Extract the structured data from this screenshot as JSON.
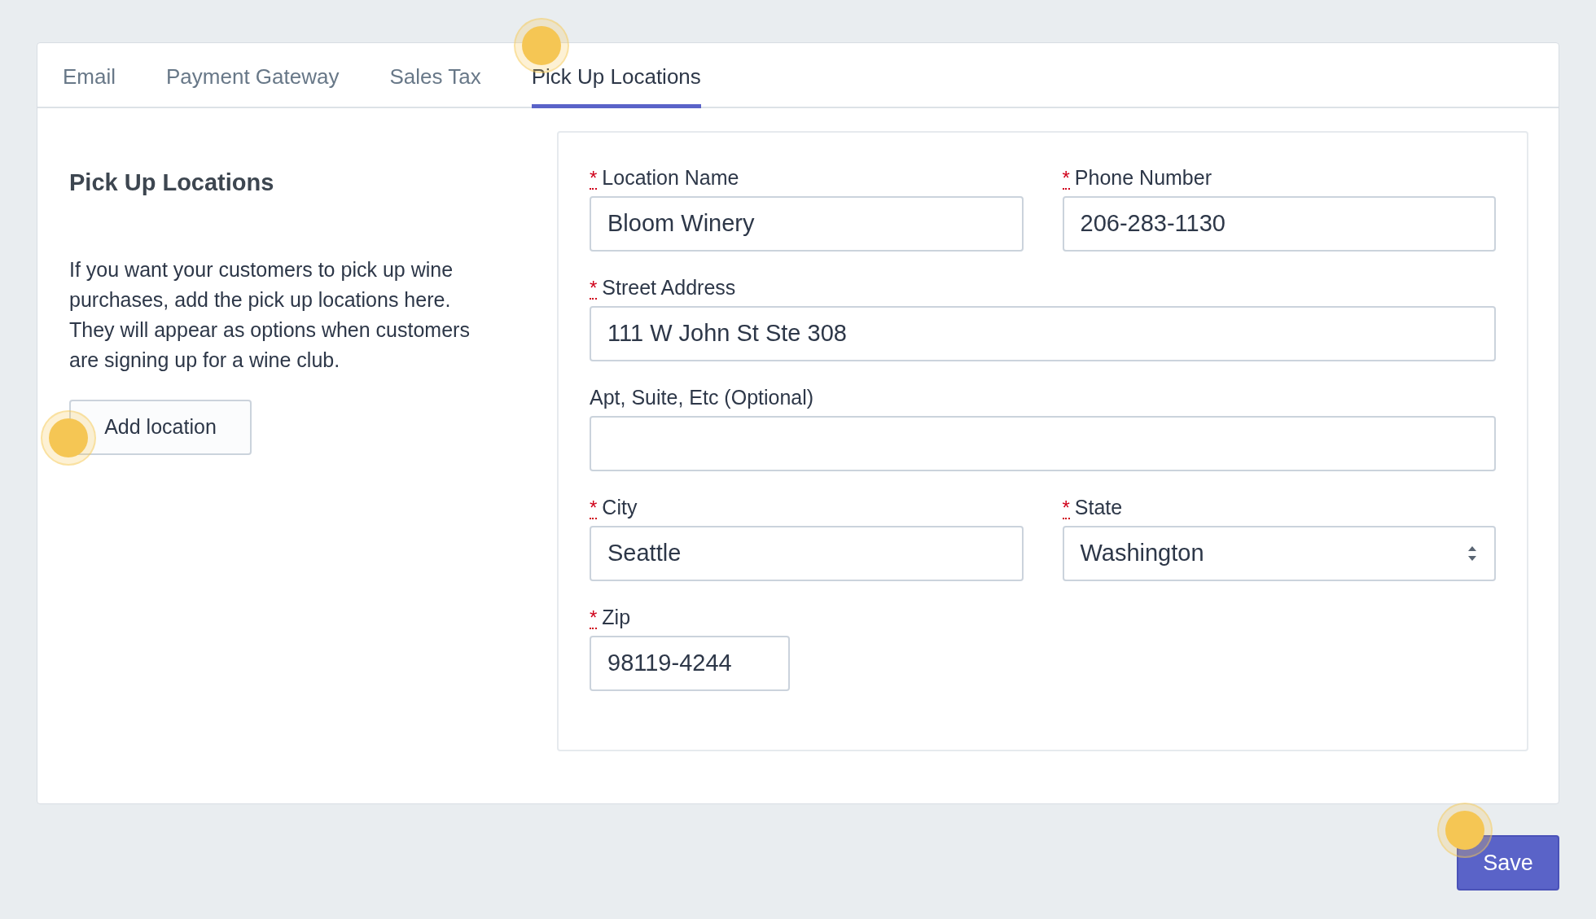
{
  "tabs": [
    {
      "label": "Email",
      "selected": false
    },
    {
      "label": "Payment Gateway",
      "selected": false
    },
    {
      "label": "Sales Tax",
      "selected": false
    },
    {
      "label": "Pick Up Locations",
      "selected": true
    }
  ],
  "section": {
    "title": "Pick Up Locations",
    "description": "If you want your customers to pick up wine purchases, add the pick up locations here. They will appear as options when customers are signing up for a wine club.",
    "add_button": "Add location"
  },
  "form_rows": [
    [
      {
        "label": "Location Name",
        "required_mark": "*",
        "kind": "text",
        "value": "Bloom Winery"
      },
      {
        "label": "Phone Number",
        "required_mark": "*",
        "kind": "text",
        "value": "206-283-1130"
      }
    ],
    [
      {
        "label": "Street Address",
        "required_mark": "*",
        "kind": "text",
        "value": "111 W John St Ste 308"
      }
    ],
    [
      {
        "label": "Apt, Suite, Etc (Optional)",
        "kind": "text"
      }
    ],
    [
      {
        "label": "City",
        "required_mark": "*",
        "kind": "text",
        "value": "Seattle"
      },
      {
        "label": "State",
        "required_mark": "*",
        "kind": "select",
        "value": "Washington"
      }
    ],
    [
      {
        "label": "Zip",
        "required_mark": "*",
        "kind": "short",
        "value": "98119-4244"
      }
    ]
  ],
  "save_button": "Save"
}
